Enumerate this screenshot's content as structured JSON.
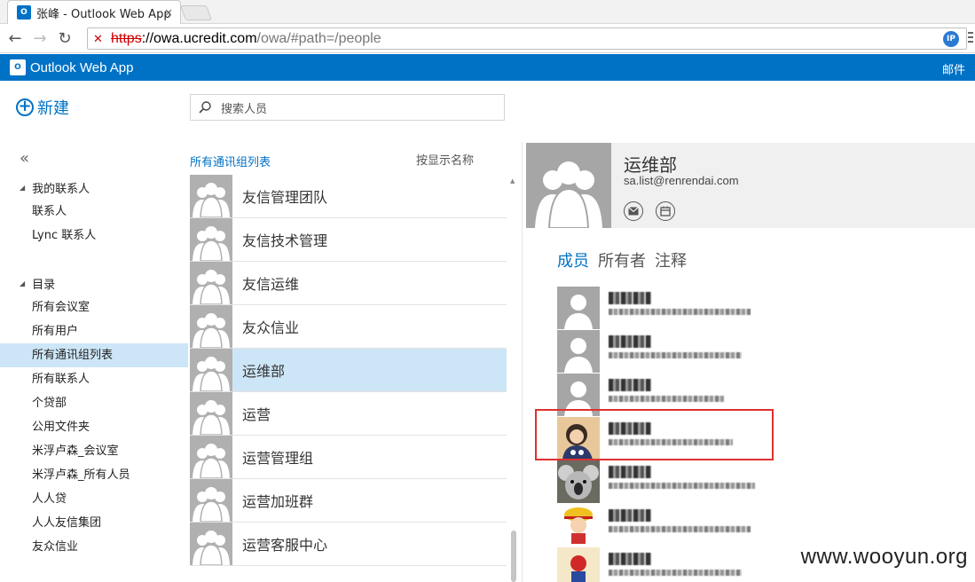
{
  "browser": {
    "tab_title": "张峰 - Outlook Web App",
    "tab_icon_text": "O",
    "close_glyph": "×",
    "back_glyph": "←",
    "forward_glyph": "→",
    "reload_glyph": "↻",
    "lock_glyph": "✕",
    "url_scheme": "https",
    "url_host": "://owa.ucredit.com",
    "url_rest": "/owa/#path=/people",
    "ext_label": "IP"
  },
  "header": {
    "logo_text": "O",
    "app_title": "Outlook Web App",
    "mail_link": "邮件"
  },
  "sidebar": {
    "new_glyph": "+",
    "new_label": "新建",
    "collapse_glyph": "«",
    "my_contacts": {
      "label": "我的联系人",
      "items": [
        "联系人",
        "Lync 联系人"
      ]
    },
    "directory": {
      "label": "目录",
      "items": [
        "所有会议室",
        "所有用户",
        "所有通讯组列表",
        "所有联系人",
        "个贷部",
        "公用文件夹",
        "米浮卢森_会议室",
        "米浮卢森_所有人员",
        "人人贷",
        "人人友信集团",
        "友众信业"
      ],
      "selected_index": 2
    }
  },
  "search": {
    "placeholder": "搜索人员"
  },
  "list": {
    "title": "所有通讯组列表",
    "sort_label": "按显示名称",
    "items": [
      "友信管理团队",
      "友信技术管理",
      "友信运维",
      "友众信业",
      "运维部",
      "运营",
      "运营管理组",
      "运营加班群",
      "运营客服中心"
    ],
    "selected_index": 4
  },
  "detail": {
    "name": "运维部",
    "email": "sa.list@renrendai.com",
    "tabs": [
      "成员",
      "所有者",
      "注释"
    ],
    "active_tab": 0,
    "member_count_shown": 7
  },
  "watermark": "www.wooyun.org",
  "colors": {
    "accent": "#0072c6",
    "selected_bg": "#cde6f7",
    "highlight": "#e03030"
  }
}
